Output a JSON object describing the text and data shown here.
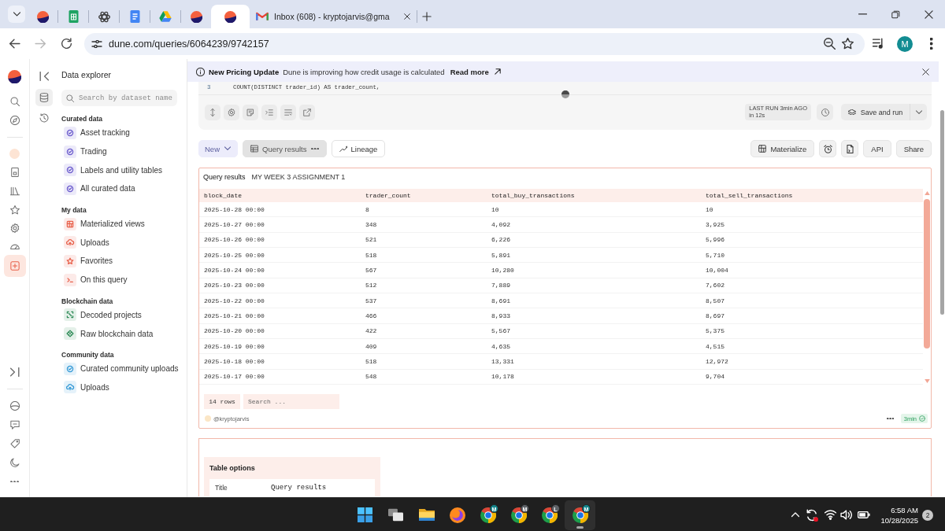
{
  "browser": {
    "tabs": [
      {
        "kind": "logo",
        "selected": false
      },
      {
        "kind": "sheet",
        "selected": false
      },
      {
        "kind": "atom",
        "selected": false
      },
      {
        "kind": "document",
        "selected": false
      },
      {
        "kind": "drive",
        "selected": false
      },
      {
        "kind": "logo",
        "selected": false
      },
      {
        "kind": "logo",
        "selected": true
      },
      {
        "kind": "mail",
        "title": "Inbox (608) - kryptojarvis@gma",
        "selected": false
      }
    ],
    "nav": [
      {
        "kind": "back",
        "disabled": false
      },
      {
        "kind": "forward",
        "disabled": true
      },
      {
        "kind": "reload",
        "disabled": false
      }
    ],
    "url": "dune.com/queries/6064239/9742157",
    "profile": "M"
  },
  "rail": {
    "top": [
      [
        {
          "kind": "logo",
          "selected": false
        },
        {
          "kind": "search",
          "selected": false
        },
        {
          "kind": "compass",
          "selected": false
        }
      ],
      [
        {
          "kind": "avatar",
          "selected": false
        },
        {
          "kind": "document",
          "selected": false
        },
        {
          "kind": "books",
          "selected": false
        },
        {
          "kind": "star",
          "selected": false
        },
        {
          "kind": "settings",
          "selected": false
        },
        {
          "kind": "gauge",
          "selected": false
        },
        {
          "kind": "add",
          "selected": true
        }
      ]
    ],
    "bottom": [
      [
        {
          "kind": "expand",
          "selected": false
        }
      ],
      [
        {
          "kind": "globe",
          "selected": false
        },
        {
          "kind": "chat",
          "selected": false
        },
        {
          "kind": "tag",
          "selected": false
        },
        {
          "kind": "moon",
          "selected": false
        },
        {
          "kind": "more",
          "selected": false
        }
      ]
    ]
  },
  "explorer": {
    "tools": [
      {
        "kind": "collapse",
        "selected": false
      },
      {
        "kind": "database",
        "selected": true
      },
      {
        "kind": "history",
        "selected": false
      }
    ],
    "title": "Data explorer",
    "search": {
      "placeholder": "Search by dataset name"
    },
    "sections": [
      {
        "kind": "curated",
        "title": "Curated data",
        "items": [
          {
            "kind": "check",
            "label": "Asset tracking"
          },
          {
            "kind": "check",
            "label": "Trading"
          },
          {
            "kind": "check",
            "label": "Labels and utility tables"
          },
          {
            "kind": "check",
            "label": "All curated data"
          }
        ]
      },
      {
        "kind": "personal",
        "title": "My data",
        "items": [
          {
            "kind": "grid",
            "label": "Materialized views"
          },
          {
            "kind": "upload",
            "label": "Uploads"
          },
          {
            "kind": "star",
            "label": "Favorites"
          },
          {
            "kind": "terminal",
            "label": "On this query"
          }
        ]
      },
      {
        "kind": "chain",
        "title": "Blockchain data",
        "items": [
          {
            "kind": "decoded",
            "label": "Decoded projects"
          },
          {
            "kind": "diamond",
            "label": "Raw blockchain data"
          }
        ]
      },
      {
        "kind": "community",
        "title": "Community data",
        "items": [
          {
            "kind": "check",
            "label": "Curated community uploads"
          },
          {
            "kind": "upload",
            "label": "Uploads"
          }
        ]
      }
    ]
  },
  "banner": {
    "title": "New Pricing Update",
    "message": "Dune is improving how credit usage is calculated",
    "link": "Read more"
  },
  "editor": {
    "lines": [
      {
        "number": "3",
        "code": "COUNT(DISTINCT trader_id) AS trader_count,"
      }
    ],
    "tools": [
      {
        "kind": "updown"
      },
      {
        "kind": "settings"
      },
      {
        "kind": "notes"
      },
      {
        "kind": "indent"
      },
      {
        "kind": "format"
      },
      {
        "kind": "share"
      }
    ],
    "last_run": "LAST RUN 3min AGO",
    "duration": "in 12s",
    "run_button": "Save and run"
  },
  "results_bar": {
    "new_button": "New",
    "views": [
      {
        "kind": "table",
        "label": "Query results",
        "selected": true
      },
      {
        "kind": "lineage",
        "label": "Lineage",
        "selected": false
      }
    ],
    "actions": [
      {
        "kind": "materialize",
        "label": "Materialize"
      },
      {
        "kind": "alarm"
      },
      {
        "kind": "file"
      },
      {
        "kind": "text",
        "label": "API"
      },
      {
        "kind": "text",
        "label": "Share"
      }
    ]
  },
  "results": {
    "title": "Query results",
    "name": "MY WEEK 3 ASSIGNMENT 1",
    "table": {
      "columns": [
        "block_date",
        "trader_count",
        "total_buy_transactions",
        "total_sell_transactions"
      ],
      "rows": [
        [
          "2025-10-28 00:00",
          "8",
          "10",
          "10"
        ],
        [
          "2025-10-27 00:00",
          "348",
          "4,092",
          "3,925"
        ],
        [
          "2025-10-26 00:00",
          "521",
          "6,226",
          "5,996"
        ],
        [
          "2025-10-25 00:00",
          "518",
          "5,891",
          "5,710"
        ],
        [
          "2025-10-24 00:00",
          "567",
          "10,280",
          "10,004"
        ],
        [
          "2025-10-23 00:00",
          "512",
          "7,889",
          "7,602"
        ],
        [
          "2025-10-22 00:00",
          "537",
          "8,691",
          "8,507"
        ],
        [
          "2025-10-21 00:00",
          "466",
          "8,933",
          "8,697"
        ],
        [
          "2025-10-20 00:00",
          "422",
          "5,567",
          "5,375"
        ],
        [
          "2025-10-19 00:00",
          "409",
          "4,635",
          "4,515"
        ],
        [
          "2025-10-18 00:00",
          "518",
          "13,331",
          "12,972"
        ],
        [
          "2025-10-17 00:00",
          "548",
          "10,178",
          "9,704"
        ]
      ]
    },
    "row_count": "14 rows",
    "search": {
      "placeholder": "Search ..."
    },
    "author": "@kryptojarvis",
    "age": "3min"
  },
  "table_options": {
    "title": "Table options",
    "fields": [
      {
        "label": "Title",
        "value": "Query results"
      }
    ]
  },
  "taskbar": {
    "apps": [
      {
        "kind": "start",
        "selected": false
      },
      {
        "kind": "taskview",
        "selected": false
      },
      {
        "kind": "folder",
        "selected": false
      },
      {
        "kind": "fox",
        "selected": false
      },
      {
        "kind": "wheel",
        "badge": "M",
        "color": "#14868c",
        "selected": false
      },
      {
        "kind": "wheel",
        "badge": "M",
        "color": "#5f6368",
        "selected": false
      },
      {
        "kind": "wheel",
        "badge": "L",
        "color": "#5f6368",
        "selected": false
      },
      {
        "kind": "wheel",
        "badge": "M",
        "color": "#14868c",
        "selected": true
      }
    ],
    "tray": [
      {
        "kind": "chevron"
      },
      {
        "kind": "sync"
      },
      {
        "kind": "wifi"
      },
      {
        "kind": "volume"
      },
      {
        "kind": "battery"
      }
    ],
    "time": "6:58 AM",
    "date": "10/28/2025",
    "notifications": "2"
  }
}
